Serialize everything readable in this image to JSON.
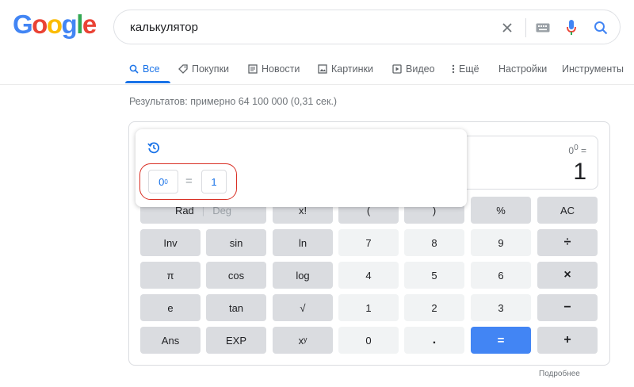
{
  "logo": {
    "letters": [
      "G",
      "o",
      "o",
      "g",
      "l",
      "e"
    ]
  },
  "search": {
    "query": "калькулятор"
  },
  "tabs": [
    {
      "label": "Все",
      "icon": "search-icon",
      "active": true
    },
    {
      "label": "Покупки",
      "icon": "tag-icon"
    },
    {
      "label": "Новости",
      "icon": "news-icon"
    },
    {
      "label": "Картинки",
      "icon": "image-icon"
    },
    {
      "label": "Видео",
      "icon": "video-icon"
    },
    {
      "label": "Ещё",
      "icon": "more-vert-icon"
    },
    {
      "label": "Настройки"
    },
    {
      "label": "Инструменты"
    }
  ],
  "stats": "Результатов: примерно 64 100 000 (0,31 сек.)",
  "calculator": {
    "expression_base": "0",
    "expression_exp": "0",
    "expression_eq": "=",
    "result": "1",
    "rows": [
      [
        "Rad | Deg",
        "x!",
        "(",
        ")",
        "%",
        "AC"
      ],
      [
        "Inv",
        "sin",
        "ln",
        "7",
        "8",
        "9",
        "÷"
      ],
      [
        "π",
        "cos",
        "log",
        "4",
        "5",
        "6",
        "×"
      ],
      [
        "e",
        "tan",
        "√",
        "1",
        "2",
        "3",
        "−"
      ],
      [
        "Ans",
        "EXP",
        "xʸ",
        "0",
        ".",
        "=",
        "+"
      ]
    ],
    "rad_label": "Rad",
    "deg_label": "Deg",
    "history": {
      "base": "0",
      "exp": "0",
      "eq": "=",
      "result": "1"
    }
  },
  "more_link": "Подробнее",
  "colors": {
    "accent": "#4285f4",
    "link": "#1a73e8",
    "highlight": "#d93025"
  }
}
